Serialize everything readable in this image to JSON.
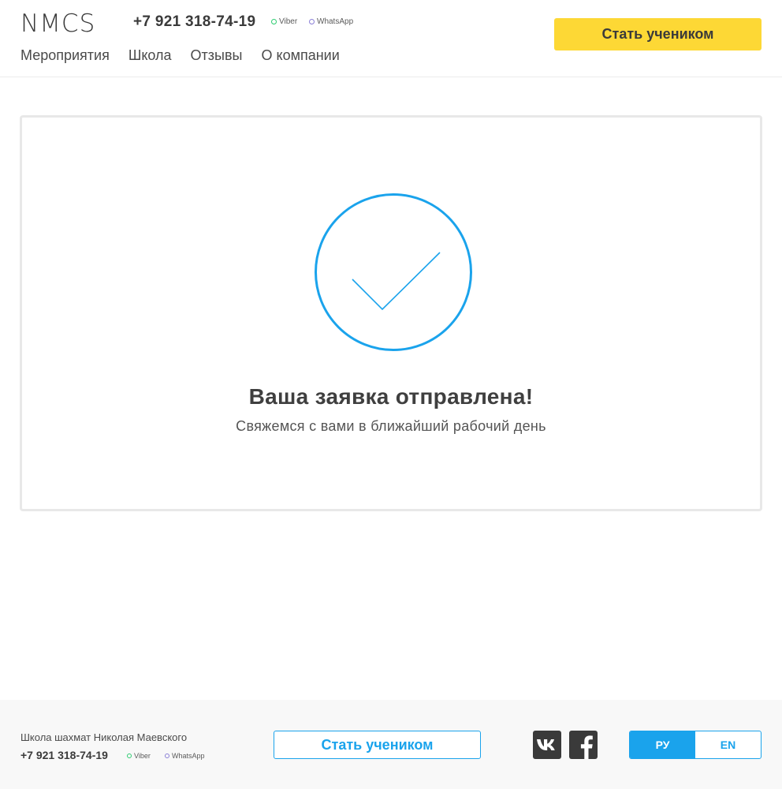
{
  "header": {
    "logo": "NMCS",
    "phone": "+7 921 318-74-19",
    "messengers": [
      "Viber",
      "WhatsApp"
    ],
    "nav": [
      "Мероприятия",
      "Школа",
      "Отзывы",
      "О компании"
    ],
    "cta_label": "Стать учеником"
  },
  "main": {
    "icon": "check-circle-icon",
    "title": "Ваша заявка отправлена!",
    "subtitle": "Свяжемся с вами в ближайший рабочий день"
  },
  "footer": {
    "school_name": "Школа шахмат Николая Маевского",
    "phone": "+7 921 318-74-19",
    "messengers": [
      "Viber",
      "WhatsApp"
    ],
    "cta_label": "Стать учеником",
    "social": [
      "vk-icon",
      "facebook-icon"
    ],
    "languages": [
      "РУ",
      "EN"
    ],
    "active_language": "РУ"
  },
  "colors": {
    "accent_blue": "#1aa3ec",
    "accent_yellow": "#fdd835",
    "viber_dot": "#2ecc71",
    "whatsapp_dot": "#8a7fd6",
    "text": "#3a3a3a"
  }
}
